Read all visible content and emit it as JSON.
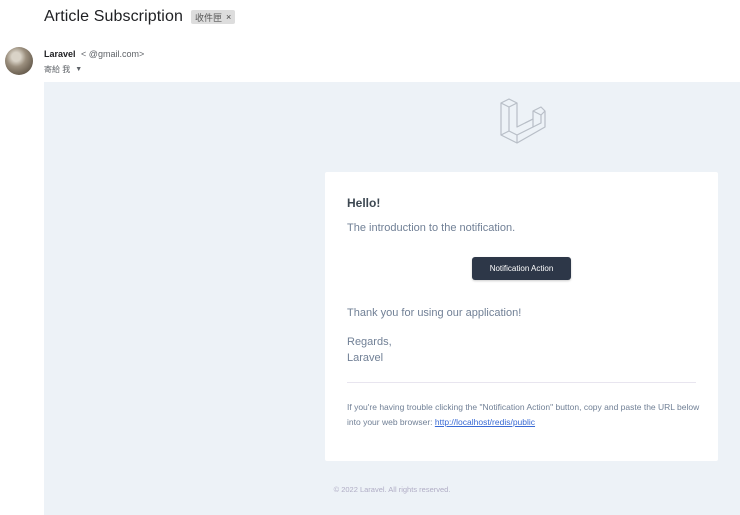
{
  "email": {
    "subject": "Article Subscription",
    "label_chip": "收件匣",
    "label_chip_close": "×",
    "sender_name": "Laravel",
    "sender_email": "<           @gmail.com>",
    "to_text": "寄給 我",
    "to_caret": "▼"
  },
  "message": {
    "greeting": "Hello!",
    "intro": "The introduction to the notification.",
    "action_label": "Notification Action",
    "outro": "Thank you for using our application!",
    "salutation_line1": "Regards,",
    "salutation_line2": "Laravel",
    "subcopy_text": "If you're having trouble clicking the \"Notification Action\" button, copy and paste the URL below into your web browser: ",
    "action_url": "http://localhost/redis/public",
    "footer": "© 2022 Laravel. All rights reserved."
  },
  "colors": {
    "canvas_bg": "#edf2f7",
    "button_bg": "#2d3748",
    "link": "#3869d4",
    "body_text": "#718096",
    "heading": "#3d4852"
  },
  "icons": {
    "logo": "laravel-logo-icon",
    "avatar": "sender-avatar"
  }
}
